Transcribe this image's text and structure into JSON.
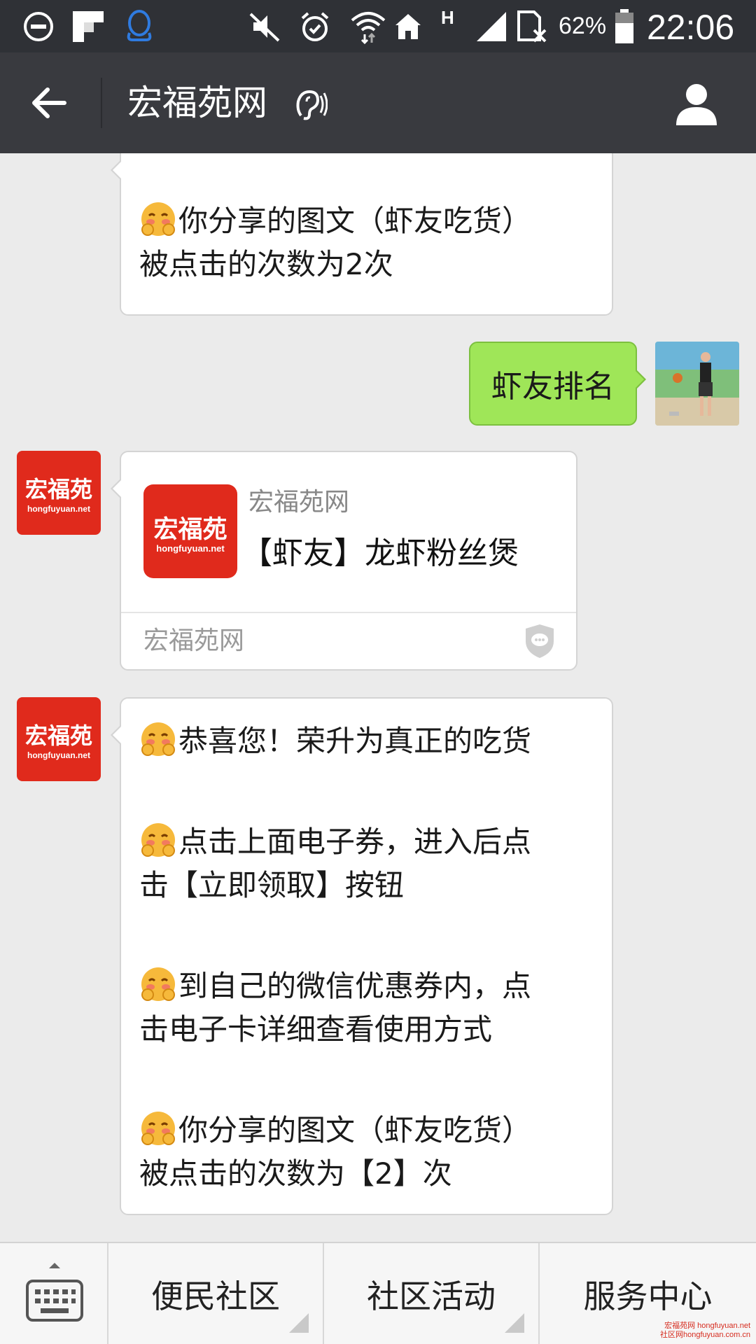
{
  "status_bar": {
    "battery": "62%",
    "time": "22:06",
    "network_type": "H",
    "icons": [
      "minus-circle-icon",
      "flipboard-icon",
      "qq-icon",
      "mute-icon",
      "alarm-icon",
      "wifi-icon",
      "home-icon",
      "signal-icon",
      "no-sim-icon",
      "battery-icon"
    ]
  },
  "nav": {
    "title": "宏福苑网",
    "back_icon": "arrow-left-icon",
    "earpiece_icon": "ear-icon",
    "profile_icon": "user-icon"
  },
  "messages": [
    {
      "type": "text",
      "side": "left",
      "lines": [
        "你分享的图文（虾友吃货）",
        "被点击的次数为2次"
      ]
    },
    {
      "type": "text",
      "side": "right",
      "text": "虾友排名"
    },
    {
      "type": "card",
      "side": "left",
      "card_title": "宏福苑网",
      "headline": "【虾友】龙虾粉丝煲",
      "source": "宏福苑网"
    },
    {
      "type": "text",
      "side": "left",
      "paragraphs": [
        [
          "恭喜您！荣升为真正的吃货"
        ],
        [
          "点击上面电子券，进入后点",
          "击【立即领取】按钮"
        ],
        [
          "到自己的微信优惠券内，点",
          "击电子卡详细查看使用方式"
        ],
        [
          "你分享的图文（虾友吃货）",
          "被点击的次数为【2】次"
        ]
      ]
    }
  ],
  "logo": {
    "big": "宏福苑",
    "small": "hongfuyuan.net"
  },
  "bottom_menu": {
    "keyboard_icon": "keyboard-icon",
    "items": [
      "便民社区",
      "社区活动",
      "服务中心"
    ]
  },
  "watermark": {
    "line1": "宏福苑网 hongfuyuan.net",
    "line2": "社区网hongfuyuan.com.cn"
  },
  "colors": {
    "status_bar": "#2f3136",
    "nav_bar": "#393a3f",
    "chat_bg": "#ebebeb",
    "sent_bubble": "#9fe658",
    "logo_red": "#e02a1c"
  }
}
